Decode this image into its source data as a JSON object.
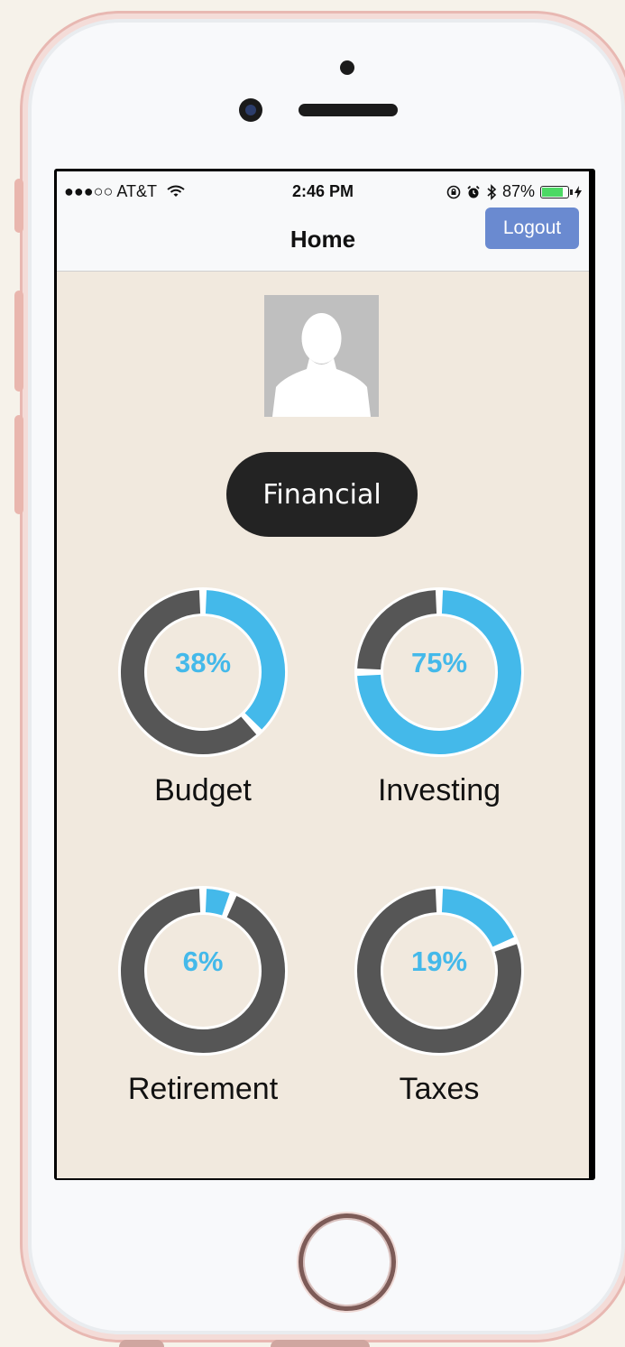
{
  "status_bar": {
    "carrier": "●●●○○ AT&T",
    "time": "2:46 PM",
    "battery_percent": "87%",
    "battery_level": 0.87
  },
  "nav": {
    "title": "Home",
    "logout_label": "Logout"
  },
  "profile": {
    "avatar_icon": "person-silhouette-icon"
  },
  "category": {
    "label": "Financial"
  },
  "metrics": [
    {
      "label": "Budget",
      "percent_text": "38%",
      "value": 38
    },
    {
      "label": "Investing",
      "percent_text": "75%",
      "value": 75
    },
    {
      "label": "Retirement",
      "percent_text": "6%",
      "value": 6
    },
    {
      "label": "Taxes",
      "percent_text": "19%",
      "value": 19
    }
  ],
  "colors": {
    "progress": "#44b9ea",
    "track": "#565656",
    "background": "#f1e9de",
    "logout_button": "#6a8ad0",
    "category_pill": "#232323"
  }
}
